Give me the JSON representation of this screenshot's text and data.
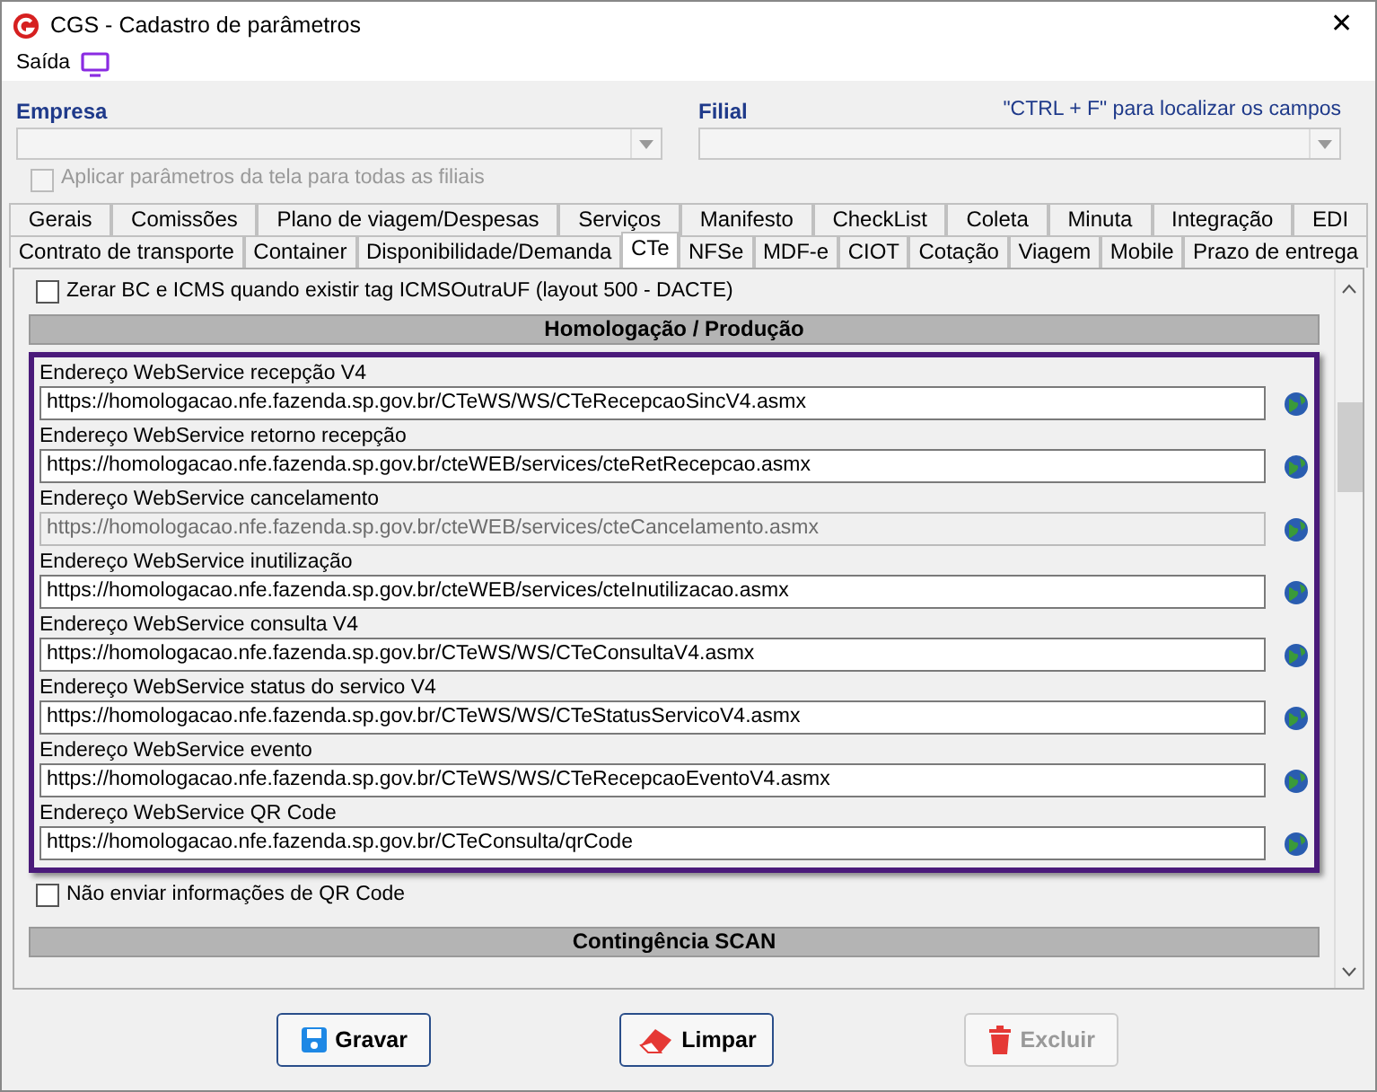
{
  "window": {
    "title": "CGS - Cadastro de parâmetros",
    "close": "✕"
  },
  "menu": [
    {
      "label": "Saída"
    }
  ],
  "empresa": {
    "label": "Empresa"
  },
  "filial": {
    "label": "Filial",
    "hint": "\"CTRL + F\" para localizar os campos"
  },
  "apply_all": {
    "label": "Aplicar parâmetros da tela para todas as filiais",
    "checked": false,
    "disabled": true
  },
  "tab_rows": [
    [
      {
        "label": "Gerais",
        "selected": false
      },
      {
        "label": "Comissões",
        "selected": false
      },
      {
        "label": "Plano de viagem/Despesas",
        "selected": false
      },
      {
        "label": "Serviços",
        "selected": false
      },
      {
        "label": "Manifesto",
        "selected": false
      },
      {
        "label": "CheckList",
        "selected": false
      },
      {
        "label": "Coleta",
        "selected": false
      },
      {
        "label": "Minuta",
        "selected": false
      },
      {
        "label": "Integração",
        "selected": false
      },
      {
        "label": "EDI",
        "selected": false
      }
    ],
    [
      {
        "label": "Contrato de transporte",
        "selected": false
      },
      {
        "label": "Container",
        "selected": false
      },
      {
        "label": "Disponibilidade/Demanda",
        "selected": false
      },
      {
        "label": "CTe",
        "selected": true
      },
      {
        "label": "NFSe",
        "selected": false
      },
      {
        "label": "MDF-e",
        "selected": false
      },
      {
        "label": "CIOT",
        "selected": false
      },
      {
        "label": "Cotação",
        "selected": false
      },
      {
        "label": "Viagem",
        "selected": false
      },
      {
        "label": "Mobile",
        "selected": false
      },
      {
        "label": "Prazo de entrega",
        "selected": false
      }
    ]
  ],
  "options": [
    {
      "label": "Zerar BC e ICMS quando existir tag ICMSOutraUF (layout 500 - DACTE)",
      "checked": false
    }
  ],
  "section_1": {
    "title": "Homologação / Produção"
  },
  "endpoints": [
    {
      "label": "Endereço WebService recepção V4",
      "value": "https://homologacao.nfe.fazenda.sp.gov.br/CTeWS/WS/CTeRecepcaoSincV4.asmx",
      "disabled": false
    },
    {
      "label": "Endereço WebService retorno recepção",
      "value": "https://homologacao.nfe.fazenda.sp.gov.br/cteWEB/services/cteRetRecepcao.asmx",
      "disabled": false
    },
    {
      "label": "Endereço WebService cancelamento",
      "value": "https://homologacao.nfe.fazenda.sp.gov.br/cteWEB/services/cteCancelamento.asmx",
      "disabled": true
    },
    {
      "label": "Endereço WebService inutilização",
      "value": "https://homologacao.nfe.fazenda.sp.gov.br/cteWEB/services/cteInutilizacao.asmx",
      "disabled": false
    },
    {
      "label": "Endereço WebService consulta V4",
      "value": "https://homologacao.nfe.fazenda.sp.gov.br/CTeWS/WS/CTeConsultaV4.asmx",
      "disabled": false
    },
    {
      "label": "Endereço WebService status do servico V4",
      "value": "https://homologacao.nfe.fazenda.sp.gov.br/CTeWS/WS/CTeStatusServicoV4.asmx",
      "disabled": false
    },
    {
      "label": "Endereço WebService evento",
      "value": "https://homologacao.nfe.fazenda.sp.gov.br/CTeWS/WS/CTeRecepcaoEventoV4.asmx",
      "disabled": false
    },
    {
      "label": "Endereço WebService QR Code",
      "value": "https://homologacao.nfe.fazenda.sp.gov.br/CTeConsulta/qrCode",
      "disabled": false
    }
  ],
  "qr_option": {
    "label": "Não enviar informações de QR Code",
    "checked": false
  },
  "section_2": {
    "title": "Contingência SCAN"
  },
  "buttons": [
    {
      "label": "Gravar",
      "kind": "save",
      "disabled": false
    },
    {
      "label": "Limpar",
      "kind": "clear",
      "disabled": false
    },
    {
      "label": "Excluir",
      "kind": "delete",
      "disabled": true
    }
  ]
}
